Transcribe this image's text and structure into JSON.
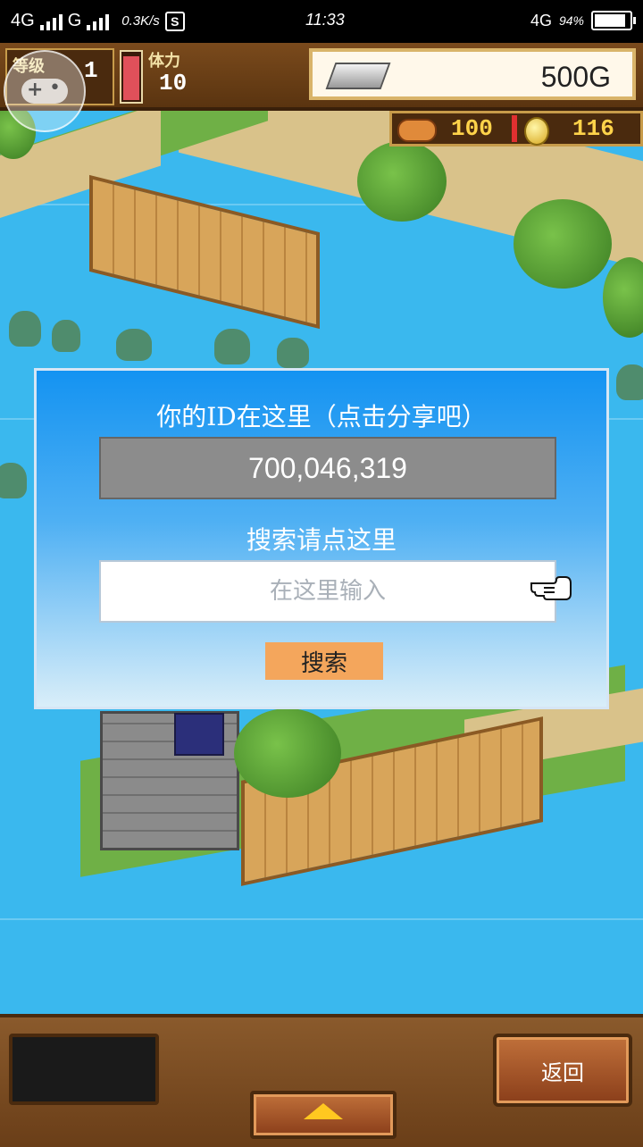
{
  "status_bar": {
    "network1": "4G",
    "network2": "G",
    "speed": "0.3K/s",
    "app_badge": "S",
    "time": "11:33",
    "network_right": "4G",
    "battery_pct": "94%"
  },
  "hud": {
    "level_label": "等级",
    "level_value": "1",
    "stamina_label": "体力",
    "stamina_value": "10",
    "stamina_fill_fraction": 0.95,
    "gold": "500G",
    "food": "100",
    "coins": "116"
  },
  "dialog": {
    "title": "你的ID在这里（点击分享吧）",
    "user_id": "700,046,319",
    "search_label": "搜索请点这里",
    "search_placeholder": "在这里输入",
    "search_button": "搜索"
  },
  "bottom": {
    "back_button": "返回"
  },
  "colors": {
    "dialog_top": "#1493f2",
    "dialog_bottom": "#d9eef9",
    "search_button": "#f4a65c",
    "id_box": "#8c8c8c",
    "water": "#3ab8ee"
  },
  "icons": [
    "controller-icon",
    "silver-bar-icon",
    "food-icon",
    "coin-icon",
    "pointing-hand-icon",
    "arrow-up-icon"
  ]
}
